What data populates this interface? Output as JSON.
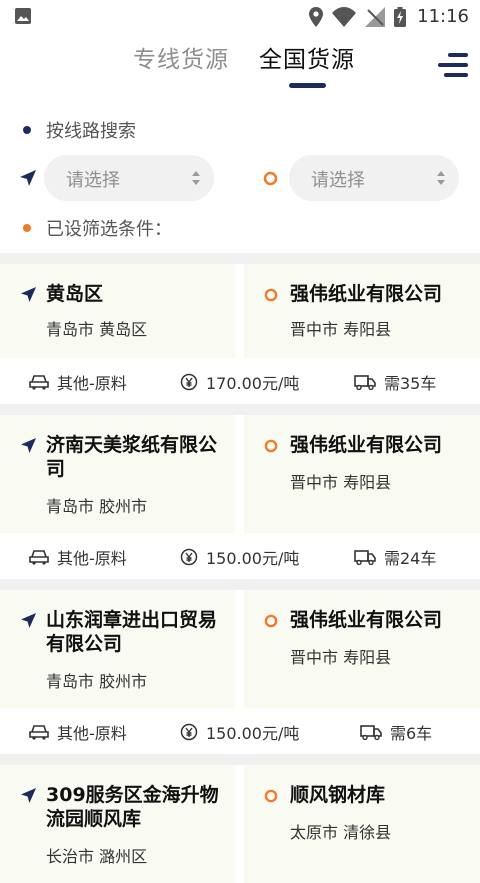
{
  "status_bar": {
    "time": "11:16"
  },
  "header": {
    "tabs": [
      "专线货源",
      "全国货源"
    ],
    "active_tab": 1
  },
  "search": {
    "route_label": "按线路搜索",
    "from_placeholder": "请选择",
    "to_placeholder": "请选择",
    "filters_label": "已设筛选条件："
  },
  "colors": {
    "navy": "#1d2a5c",
    "orange": "#f07a2a",
    "panel_bg": "#f9fbf3"
  },
  "listings": [
    {
      "from_name": "黄岛区",
      "from_sub": "青岛市 黄岛区",
      "to_name": "强伟纸业有限公司",
      "to_sub": "晋中市 寿阳县",
      "category": "其他-原料",
      "price": "170.00元/吨",
      "trucks": "需35车"
    },
    {
      "from_name": "济南天美浆纸有限公司",
      "from_sub": "青岛市 胶州市",
      "to_name": "强伟纸业有限公司",
      "to_sub": "晋中市 寿阳县",
      "category": "其他-原料",
      "price": "150.00元/吨",
      "trucks": "需24车"
    },
    {
      "from_name": "山东润章进出口贸易有限公司",
      "from_sub": "青岛市 胶州市",
      "to_name": "强伟纸业有限公司",
      "to_sub": "晋中市 寿阳县",
      "category": "其他-原料",
      "price": "150.00元/吨",
      "trucks": "需6车"
    },
    {
      "from_name": "309服务区金海升物流园顺风库",
      "from_sub": "长治市 潞州区",
      "to_name": "顺风钢材库",
      "to_sub": "太原市 清徐县",
      "category": "",
      "price": "",
      "trucks": ""
    }
  ]
}
